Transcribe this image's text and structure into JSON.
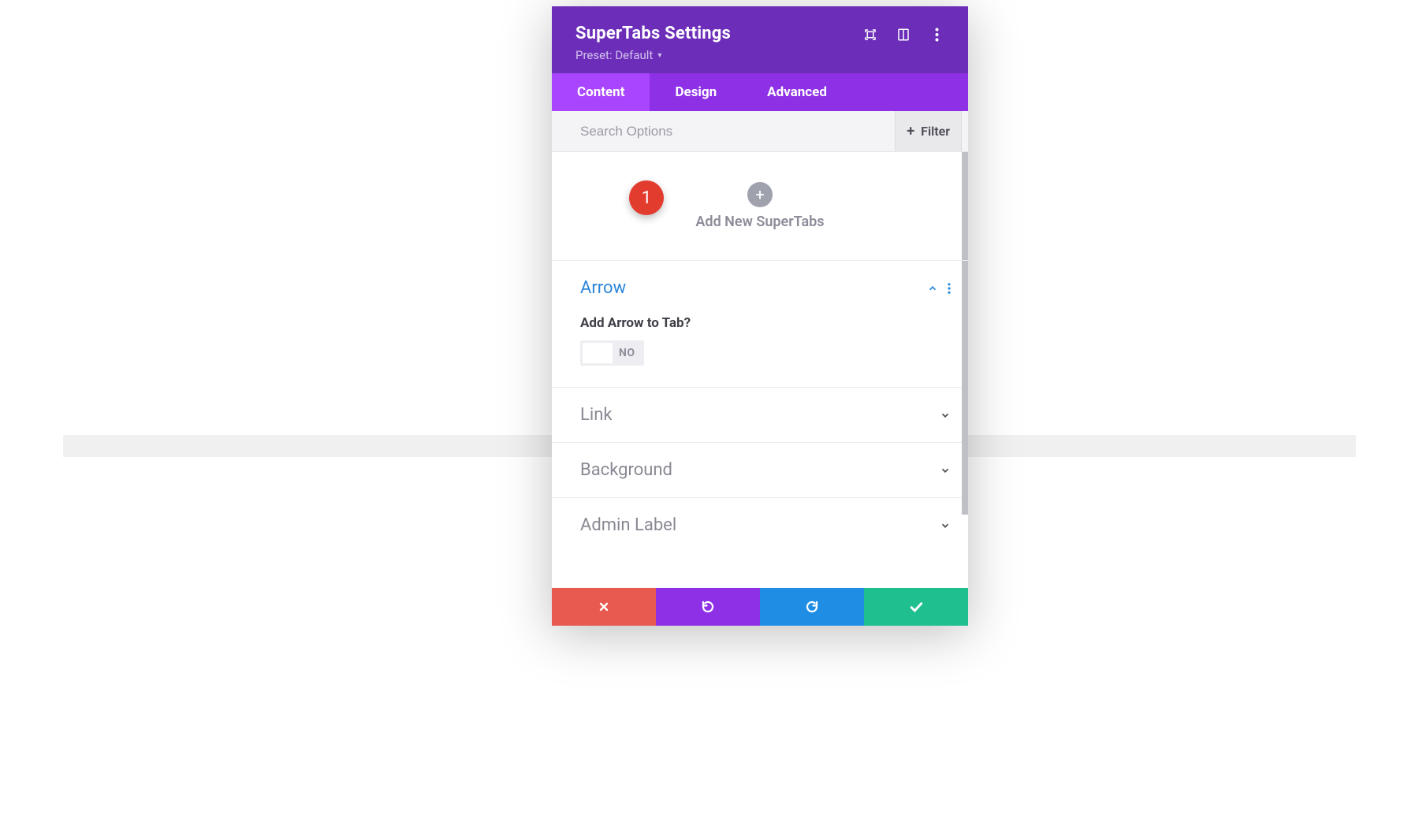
{
  "header": {
    "title": "SuperTabs Settings",
    "preset_label": "Preset: Default"
  },
  "tabs": [
    {
      "label": "Content",
      "active": true
    },
    {
      "label": "Design",
      "active": false
    },
    {
      "label": "Advanced",
      "active": false
    }
  ],
  "search": {
    "placeholder": "Search Options",
    "filter_label": "Filter"
  },
  "add_block": {
    "label": "Add New SuperTabs",
    "badge_number": "1"
  },
  "sections": {
    "arrow": {
      "title": "Arrow",
      "option_label": "Add Arrow to Tab?",
      "toggle_value": "NO"
    },
    "link": {
      "title": "Link"
    },
    "background": {
      "title": "Background"
    },
    "admin_label": {
      "title": "Admin Label"
    }
  }
}
